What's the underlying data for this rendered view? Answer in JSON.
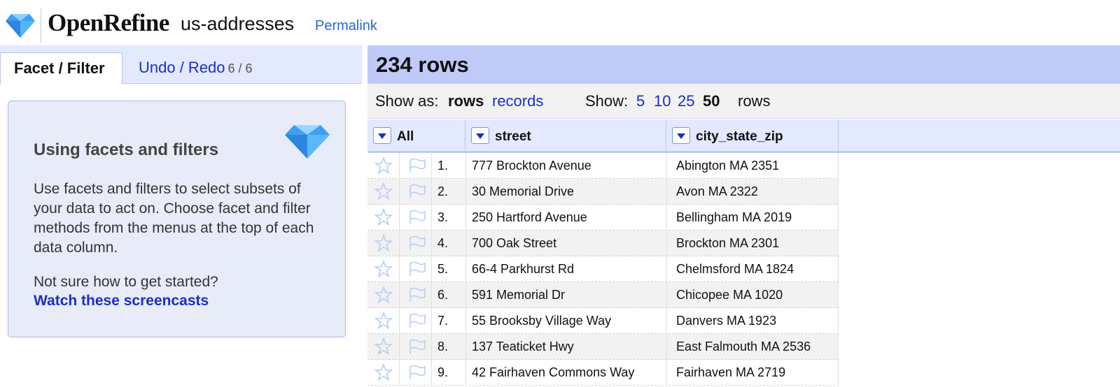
{
  "header": {
    "app_name": "OpenRefine",
    "project_name": "us-addresses",
    "permalink_label": "Permalink"
  },
  "left_panel": {
    "tabs": {
      "facet_filter": "Facet / Filter",
      "undo_redo": "Undo / Redo",
      "undo_count": "6 / 6"
    },
    "help": {
      "title": "Using facets and filters",
      "body": "Use facets and filters to select subsets of your data to act on. Choose facet and filter methods from the menus at the top of each data column.",
      "question": "Not sure how to get started?",
      "link_label": "Watch these screencasts"
    }
  },
  "right_panel": {
    "row_count": "234 rows",
    "view": {
      "show_as_label": "Show as:",
      "rows_option": "rows",
      "records_option": "records",
      "show_label": "Show:",
      "page_sizes": [
        "5",
        "10",
        "25",
        "50"
      ],
      "selected_page_size": "50",
      "rows_suffix": "rows"
    },
    "columns": [
      "All",
      "street",
      "city_state_zip"
    ],
    "rows": [
      {
        "num": "1.",
        "street": "777 Brockton Avenue",
        "city": "Abington MA 2351"
      },
      {
        "num": "2.",
        "street": "30 Memorial Drive",
        "city": "Avon MA 2322"
      },
      {
        "num": "3.",
        "street": "250 Hartford Avenue",
        "city": "Bellingham MA 2019"
      },
      {
        "num": "4.",
        "street": "700 Oak Street",
        "city": "Brockton MA 2301"
      },
      {
        "num": "5.",
        "street": "66-4 Parkhurst Rd",
        "city": "Chelmsford MA 1824"
      },
      {
        "num": "6.",
        "street": "591 Memorial Dr",
        "city": "Chicopee MA 1020"
      },
      {
        "num": "7.",
        "street": "55 Brooksby Village Way",
        "city": "Danvers MA 1923"
      },
      {
        "num": "8.",
        "street": "137 Teaticket Hwy",
        "city": "East Falmouth MA 2536"
      },
      {
        "num": "9.",
        "street": "42 Fairhaven Commons Way",
        "city": "Fairhaven MA 2719"
      }
    ]
  },
  "colors": {
    "link_blue": "#1a2ec4",
    "panel_blue": "#bfcaf7",
    "tab_bg": "#e3e9ff",
    "help_bg": "#e8ecf8"
  },
  "icons": {
    "logo": "diamond-logo-icon",
    "help": "diamond-icon",
    "column_menu": "dropdown-arrow-icon",
    "star": "star-icon",
    "flag": "flag-icon"
  }
}
